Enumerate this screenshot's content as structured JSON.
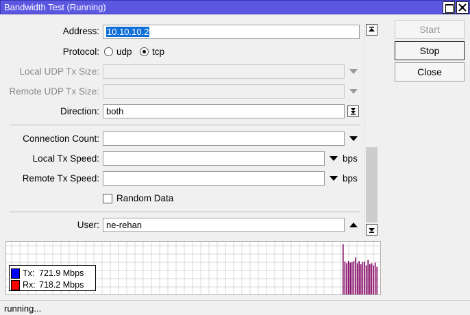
{
  "window": {
    "title": "Bandwidth Test (Running)"
  },
  "form": {
    "address": {
      "label": "Address:",
      "value": "10.10.10.2"
    },
    "protocol": {
      "label": "Protocol:",
      "options": [
        "udp",
        "tcp"
      ],
      "selected": "tcp"
    },
    "local_udp_tx_size": {
      "label": "Local UDP Tx Size:",
      "value": ""
    },
    "remote_udp_tx_size": {
      "label": "Remote UDP Tx Size:",
      "value": ""
    },
    "direction": {
      "label": "Direction:",
      "value": "both"
    },
    "connection_count": {
      "label": "Connection Count:",
      "value": ""
    },
    "local_tx_speed": {
      "label": "Local Tx Speed:",
      "value": "",
      "unit": "bps"
    },
    "remote_tx_speed": {
      "label": "Remote Tx Speed:",
      "value": "",
      "unit": "bps"
    },
    "random_data": {
      "label": "Random Data",
      "checked": false
    },
    "user": {
      "label": "User:",
      "value": "ne-rehan"
    }
  },
  "buttons": {
    "start": "Start",
    "stop": "Stop",
    "close": "Close"
  },
  "graph": {
    "legend": [
      {
        "name": "Tx:",
        "value": "721.9 Mbps",
        "color": "#0000ff"
      },
      {
        "name": "Rx:",
        "value": "718.2 Mbps",
        "color": "#ff0000"
      }
    ],
    "bar_color": "#800060",
    "bars": [
      0.98,
      0.65,
      0.62,
      0.66,
      0.63,
      0.64,
      0.66,
      0.73,
      0.62,
      0.66,
      0.6,
      0.64,
      0.65,
      0.58,
      0.68,
      0.6,
      0.62,
      0.58,
      0.63,
      0.55
    ]
  },
  "status": {
    "text": "running..."
  }
}
